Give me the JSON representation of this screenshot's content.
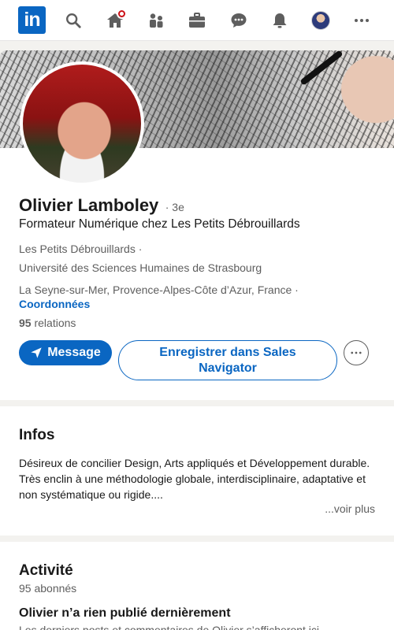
{
  "nav": {
    "logo_text": "in",
    "items": [
      {
        "name": "search-icon"
      },
      {
        "name": "home-icon",
        "badge": true
      },
      {
        "name": "my-network-icon"
      },
      {
        "name": "jobs-icon"
      },
      {
        "name": "messaging-icon"
      },
      {
        "name": "notifications-icon"
      },
      {
        "name": "me-avatar"
      },
      {
        "name": "more-icon"
      }
    ],
    "accent_color": "#0a66c2",
    "badge_color": "#cc1016"
  },
  "profile": {
    "name": "Olivier Lamboley",
    "degree": "· 3e",
    "headline": "Formateur Numérique chez Les Petits Débrouillards",
    "company": "Les Petits Débrouillards ·",
    "school": "Université des Sciences Humaines de Strasbourg",
    "location": "La Seyne-sur-Mer, Provence-Alpes-Côte d’Azur, France ·",
    "contact_link": "Coordonnées",
    "connections_count": "95",
    "connections_label": "relations",
    "message_button": "Message",
    "sales_navigator_button": "Enregistrer dans Sales Navigator",
    "more_button_icon": "more-horizontal-icon"
  },
  "infos": {
    "title": "Infos",
    "line1": "Désireux de concilier Design, Arts appliqués et Développement durable.",
    "line2": "Très enclin à une méthodologie globale, interdisciplinaire, adaptative et non systématique ou rigide....",
    "see_more": "...voir plus"
  },
  "activity": {
    "title": "Activité",
    "followers": "95 abonnés",
    "no_posts": "Olivier n’a rien publié dernièrement",
    "no_posts_sub": "Les derniers posts et commentaires de Olivier s’afficheront ici."
  }
}
